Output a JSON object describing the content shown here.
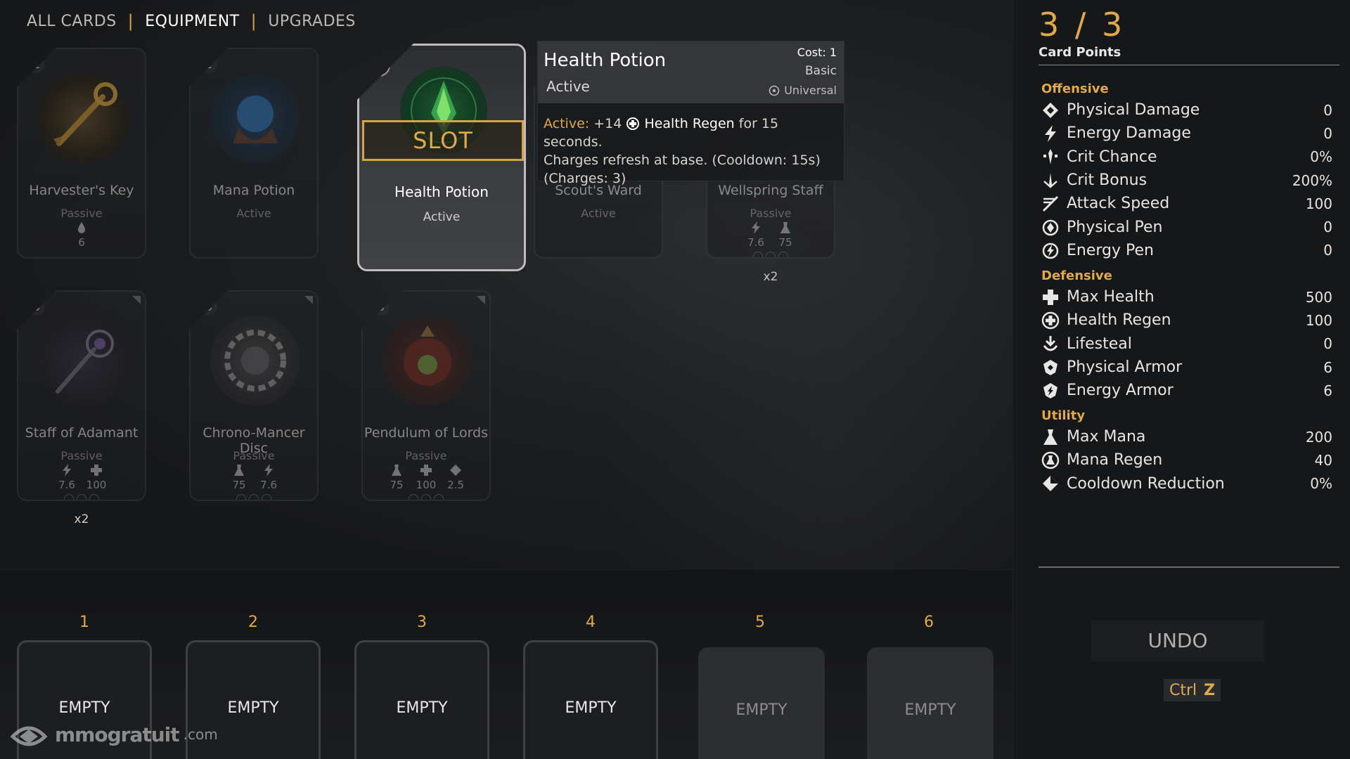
{
  "nav": {
    "tabs": [
      "ALL CARDS",
      "EQUIPMENT",
      "UPGRADES"
    ],
    "active_tab": "EQUIPMENT"
  },
  "cards": [
    {
      "cost": "1",
      "name": "Harvester's Key",
      "type": "Passive",
      "stats": [
        {
          "icon": "lifesteal-icon",
          "value": "6"
        }
      ],
      "multiplier": ""
    },
    {
      "cost": "1",
      "name": "Mana Potion",
      "type": "Active",
      "stats": [],
      "multiplier": ""
    },
    {
      "cost": "1",
      "name": "Health Potion",
      "type": "Active",
      "slot_label": "SLOT",
      "selected": true
    },
    {
      "cost": "",
      "name": "Scout's Ward",
      "type": "Active",
      "stats": [],
      "multiplier": ""
    },
    {
      "cost": "",
      "name": "Wellspring Staff",
      "type": "Passive",
      "stats": [
        {
          "icon": "energy-damage-icon",
          "value": "7.6"
        },
        {
          "icon": "max-mana-icon",
          "value": "75"
        }
      ],
      "multiplier": "x2"
    },
    {
      "cost": "3",
      "name": "Staff of Adamant",
      "type": "Passive",
      "stats": [
        {
          "icon": "energy-damage-icon",
          "value": "7.6"
        },
        {
          "icon": "max-health-icon",
          "value": "100"
        }
      ],
      "multiplier": "x2"
    },
    {
      "cost": "3",
      "name": "Chrono-Mancer Disc",
      "type": "Passive",
      "stats": [
        {
          "icon": "max-mana-icon",
          "value": "75"
        },
        {
          "icon": "energy-damage-icon",
          "value": "7.6"
        }
      ],
      "multiplier": ""
    },
    {
      "cost": "3",
      "name": "Pendulum of Lords",
      "type": "Passive",
      "stats": [
        {
          "icon": "max-mana-icon",
          "value": "75"
        },
        {
          "icon": "max-health-icon",
          "value": "100"
        },
        {
          "icon": "cooldown-reduction-icon",
          "value": "2.5"
        }
      ],
      "multiplier": ""
    }
  ],
  "tooltip": {
    "title": "Health Potion",
    "subtitle": "Active",
    "cost": "Cost: 1",
    "tier": "Basic",
    "scope": "Universal",
    "body_keyword": "Active:",
    "body_amount": "+14",
    "body_stat": "Health Regen",
    "body_rest1": "for 15 seconds.",
    "body_line2": "Charges refresh at base. (Cooldown: 15s)",
    "body_line3": "(Charges: 3)"
  },
  "slots": [
    {
      "number": "1",
      "content": "EMPTY",
      "kind": "ACTIVE"
    },
    {
      "number": "2",
      "content": "EMPTY",
      "kind": "ACTIVE"
    },
    {
      "number": "3",
      "content": "EMPTY",
      "kind": "ACTIVE"
    },
    {
      "number": "4",
      "content": "EMPTY",
      "kind": "ACTIVE"
    },
    {
      "number": "5",
      "content": "EMPTY",
      "kind": "PASSIVE"
    },
    {
      "number": "6",
      "content": "EMPTY",
      "kind": "PASSIVE"
    }
  ],
  "panel": {
    "points": "3 / 3",
    "points_label": "Card Points",
    "groups": [
      {
        "title": "Offensive",
        "stats": [
          {
            "icon": "physical-damage-icon",
            "name": "Physical Damage",
            "value": "0"
          },
          {
            "icon": "energy-damage-icon",
            "name": "Energy Damage",
            "value": "0"
          },
          {
            "icon": "crit-chance-icon",
            "name": "Crit Chance",
            "value": "0%"
          },
          {
            "icon": "crit-bonus-icon",
            "name": "Crit Bonus",
            "value": "200%"
          },
          {
            "icon": "attack-speed-icon",
            "name": "Attack Speed",
            "value": "100"
          },
          {
            "icon": "physical-pen-icon",
            "name": "Physical Pen",
            "value": "0"
          },
          {
            "icon": "energy-pen-icon",
            "name": "Energy Pen",
            "value": "0"
          }
        ]
      },
      {
        "title": "Defensive",
        "stats": [
          {
            "icon": "max-health-icon",
            "name": "Max Health",
            "value": "500"
          },
          {
            "icon": "health-regen-icon",
            "name": "Health Regen",
            "value": "100"
          },
          {
            "icon": "lifesteal-icon",
            "name": "Lifesteal",
            "value": "0"
          },
          {
            "icon": "physical-armor-icon",
            "name": "Physical Armor",
            "value": "6"
          },
          {
            "icon": "energy-armor-icon",
            "name": "Energy Armor",
            "value": "6"
          }
        ]
      },
      {
        "title": "Utility",
        "stats": [
          {
            "icon": "max-mana-icon",
            "name": "Max Mana",
            "value": "200"
          },
          {
            "icon": "mana-regen-icon",
            "name": "Mana Regen",
            "value": "40"
          },
          {
            "icon": "cooldown-reduction-icon",
            "name": "Cooldown Reduction",
            "value": "0%"
          }
        ]
      }
    ],
    "undo_label": "UNDO",
    "undo_shortcut_mod": "Ctrl",
    "undo_shortcut_key": "Z"
  },
  "watermark": {
    "brand": "mmogratuit",
    "suffix": ".com"
  },
  "colors": {
    "accent": "#e2a84c",
    "background": "#151617",
    "panel": "#161719"
  }
}
